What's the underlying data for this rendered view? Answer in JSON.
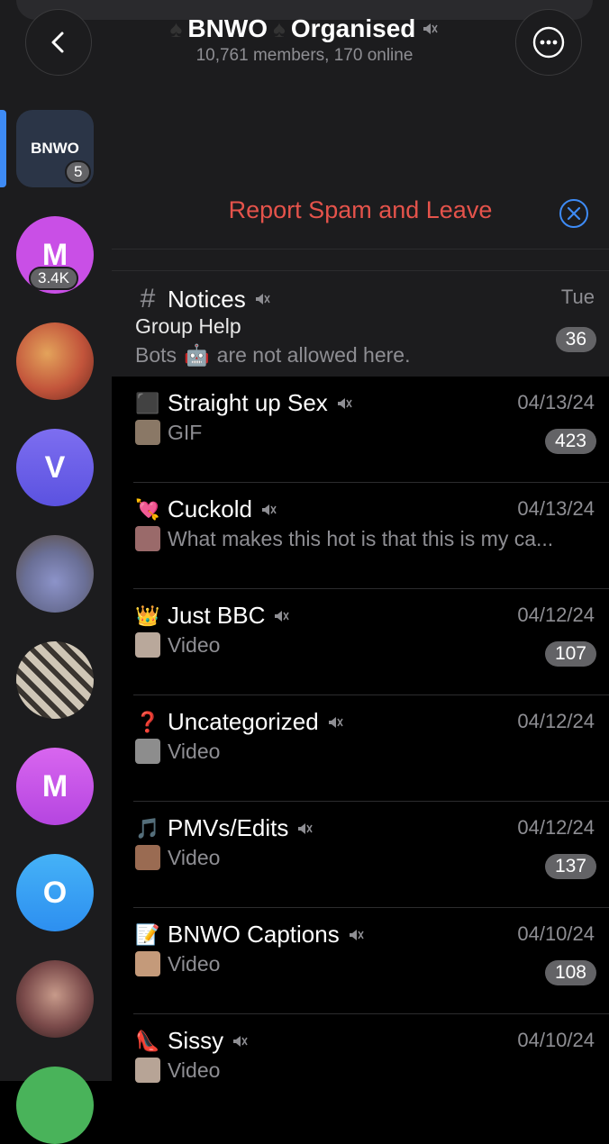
{
  "header": {
    "title_left": "BNWO",
    "title_right": "Organised",
    "subtitle": "10,761 members, 170 online",
    "back_icon": "chevron-left-icon",
    "more_icon": "more-horizontal-icon"
  },
  "spam_bar": {
    "text": "Report Spam and Leave",
    "close_icon": "close-circle-icon",
    "color": "#e5534b"
  },
  "sidebar": {
    "accent": "#3e8bf5",
    "items": [
      {
        "kind": "folder",
        "label": "BNWO",
        "badge": "5"
      },
      {
        "kind": "avatar",
        "letter": "M",
        "color": "#c94fe6",
        "badge": "3.4K"
      },
      {
        "kind": "photo",
        "color": "#c2543b"
      },
      {
        "kind": "avatar",
        "letter": "V",
        "color": "#6d5ee8"
      },
      {
        "kind": "photo",
        "color": "#6a6f96"
      },
      {
        "kind": "photo",
        "color": "#9c9486"
      },
      {
        "kind": "avatar",
        "letter": "M",
        "color": "#c94fe6"
      },
      {
        "kind": "avatar",
        "letter": "O",
        "color": "#2d8ff0"
      },
      {
        "kind": "photo",
        "color": "#7a4a4a"
      },
      {
        "kind": "avatar",
        "letter": "",
        "color": "#49b35a"
      }
    ]
  },
  "chats": [
    {
      "icon": "#",
      "title": "Notices",
      "date": "Tue",
      "line1": "Group Help",
      "line2_a": "Bots",
      "line2_emoji": "🤖",
      "line2_b": "are not allowed here.",
      "badge": "36",
      "pinned": true
    },
    {
      "icon": "⬛",
      "title": "Straight up Sex",
      "date": "04/13/24",
      "line1": "GIF",
      "badge": "423"
    },
    {
      "icon": "💘",
      "title": "Cuckold",
      "date": "04/13/24",
      "line1": "What makes this hot is that this is my ca...",
      "badge": ""
    },
    {
      "icon": "👑",
      "title": "Just BBC",
      "date": "04/12/24",
      "line1": "Video",
      "badge": "107"
    },
    {
      "icon": "❓",
      "title": "Uncategorized",
      "date": "04/12/24",
      "line1": "Video",
      "badge": ""
    },
    {
      "icon": "🎵",
      "title": "PMVs/Edits",
      "date": "04/12/24",
      "line1": "Video",
      "badge": "137"
    },
    {
      "icon": "📝",
      "title": "BNWO Captions",
      "date": "04/10/24",
      "line1": "Video",
      "badge": "108"
    },
    {
      "icon": "👠",
      "title": "Sissy",
      "date": "04/10/24",
      "line1": "Video",
      "badge": ""
    }
  ]
}
